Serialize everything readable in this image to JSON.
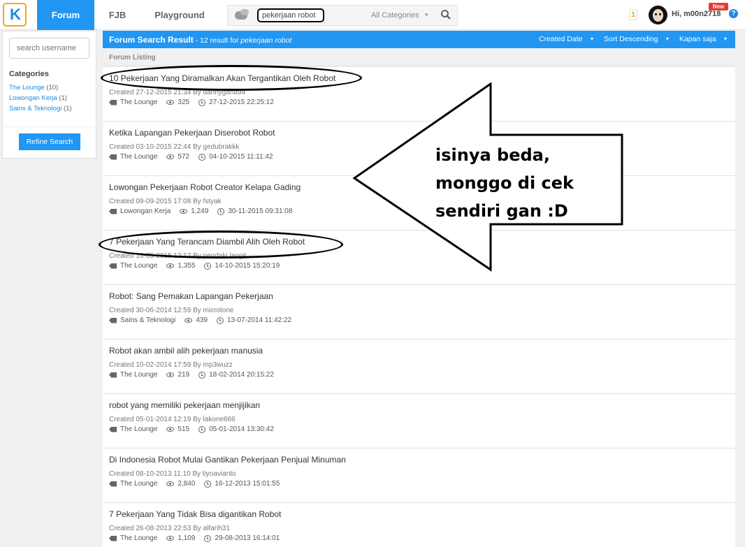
{
  "topbar": {
    "logo": "K",
    "tabs": [
      {
        "label": "Forum",
        "active": true
      },
      {
        "label": "FJB",
        "active": false
      },
      {
        "label": "Playground",
        "active": false
      }
    ],
    "search": {
      "value": "pekerjaan robot",
      "category": "All Categories"
    },
    "notification_count": "1",
    "user": "Hi, m00n2718",
    "new_badge": "New",
    "help": "?"
  },
  "sidebar": {
    "search_placeholder": "search username",
    "categories_title": "Categories",
    "categories": [
      {
        "name": "The Lounge",
        "count": "(10)"
      },
      {
        "name": "Lowongan Kerja",
        "count": "(1)"
      },
      {
        "name": "Sains & Teknologi",
        "count": "(1)"
      }
    ],
    "refine_label": "Refine Search"
  },
  "results": {
    "title": "Forum Search Result",
    "subtitle_prefix": " - 12 result for ",
    "query": "pekerjaan robot",
    "filters": [
      "Created Date",
      "Sort Descending",
      "Kapan saja"
    ],
    "listing_label": "Forum Listing"
  },
  "threads": [
    {
      "title": "10 Pekerjaan Yang Diramalkan Akan Tergantikan Oleh Robot",
      "created": "Created 27-12-2015 21:34 By ",
      "author": "dannygana94",
      "category": "The Lounge",
      "views": "325",
      "last": "27-12-2015 22:25:12"
    },
    {
      "title": "Ketika Lapangan Pekerjaan Diserobot Robot",
      "created": "Created 03-10-2015 22:44 By ",
      "author": "gedubrakkk",
      "category": "The Lounge",
      "views": "572",
      "last": "04-10-2015 11:11:42"
    },
    {
      "title": "Lowongan Pekerjaan Robot Creator Kelapa Gading",
      "created": "Created 09-09-2015 17:08 By ",
      "author": "fstyak",
      "category": "Lowongan Kerja",
      "views": "1,249",
      "last": "30-11-2015 09:31:08"
    },
    {
      "title": "7 Pekerjaan Yang Terancam Diambil Alih Oleh Robot",
      "created": "Created 16-05-2015 12:17 By ",
      "author": "pendaki langit",
      "category": "The Lounge",
      "views": "1,355",
      "last": "14-10-2015 15:20:19"
    },
    {
      "title": "Robot: Sang Pemakan Lapangan Pekerjaan",
      "created": "Created 30-06-2014 12:59 By ",
      "author": "microtone",
      "category": "Sains & Teknologi",
      "views": "439",
      "last": "13-07-2014 11:42:22"
    },
    {
      "title": "Robot akan ambil alih pekerjaan manusia",
      "created": "Created 10-02-2014 17:59 By ",
      "author": "mp3wuzz",
      "category": "The Lounge",
      "views": "219",
      "last": "18-02-2014 20:15:22"
    },
    {
      "title": "robot yang memiliki pekerjaan menjijikan",
      "created": "Created 05-01-2014 12:19 By ",
      "author": "lakone666",
      "category": "The Lounge",
      "views": "515",
      "last": "05-01-2014 13:30:42"
    },
    {
      "title": "Di Indonesia Robot Mulai Gantikan Pekerjaan Penjual Minuman",
      "created": "Created 08-10-2013 11:10 By ",
      "author": "tiyoavianto",
      "category": "The Lounge",
      "views": "2,840",
      "last": "16-12-2013 15:01:55"
    },
    {
      "title": "7 Pekerjaan Yang Tidak Bisa digantikan Robot",
      "created": "Created 26-08-2013 22:53 By ",
      "author": "alfarih31",
      "category": "The Lounge",
      "views": "1,109",
      "last": "29-08-2013 16:14:01"
    }
  ],
  "annotation": {
    "lines": [
      "isinya beda,",
      "monggo di cek",
      "sendiri gan :D"
    ]
  }
}
